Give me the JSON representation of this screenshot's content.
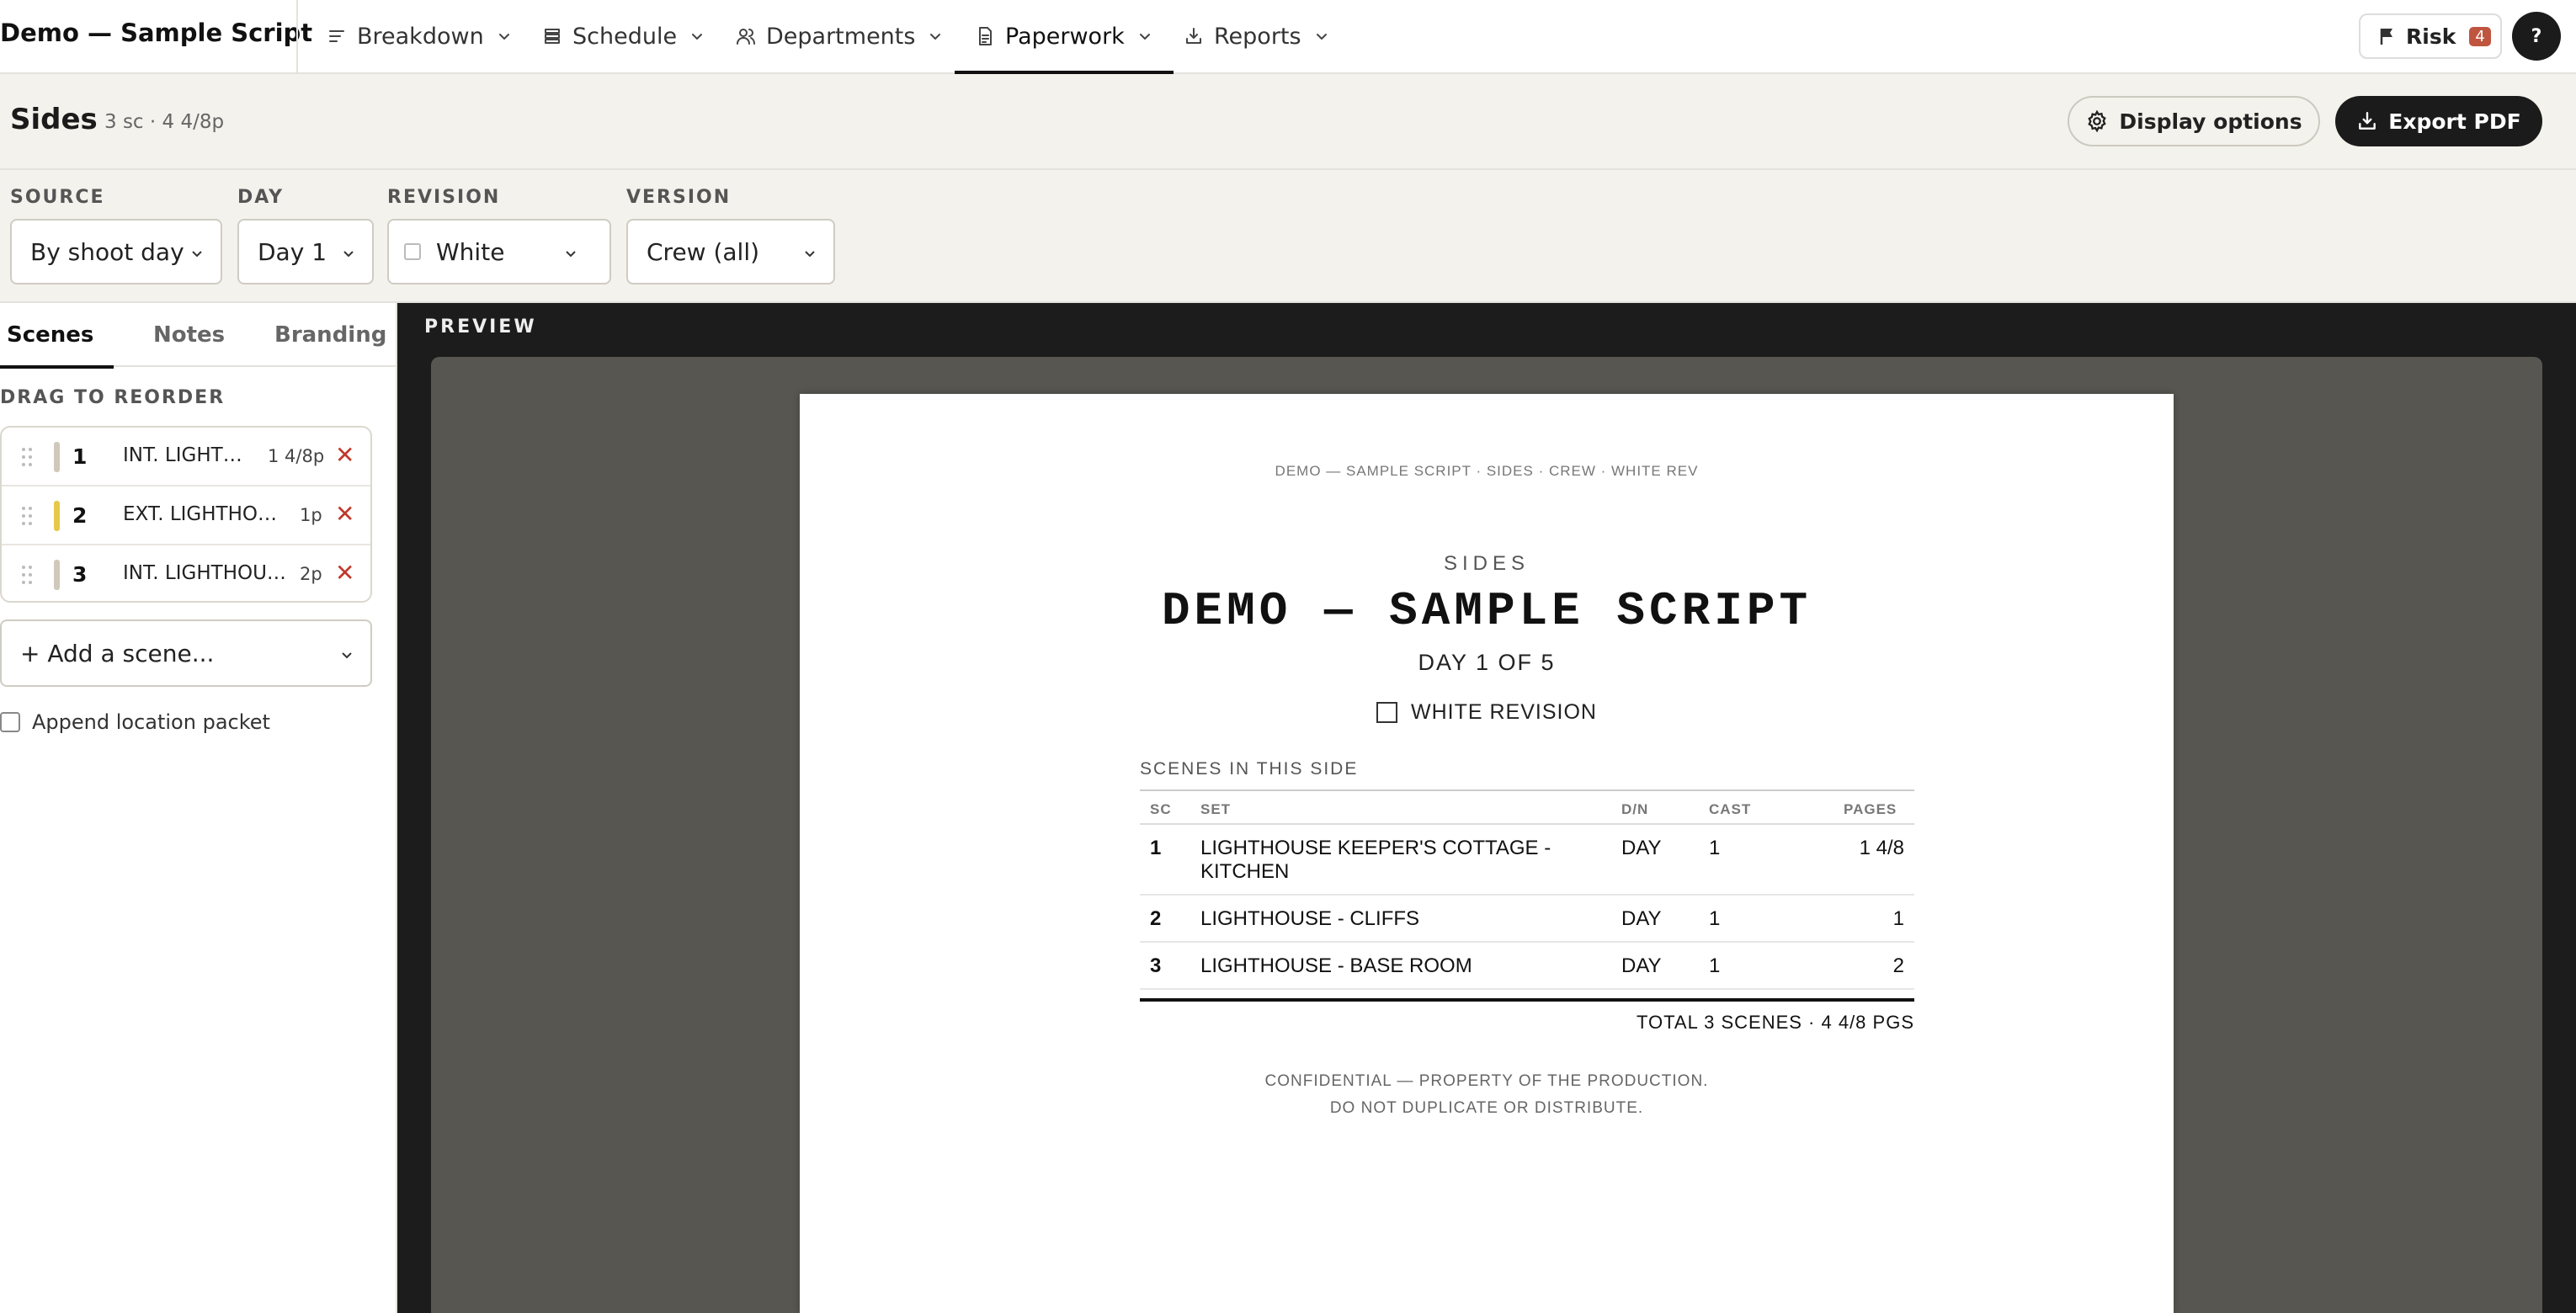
{
  "app": {
    "title": "Demo — Sample Script"
  },
  "nav": {
    "items": [
      {
        "label": "Breakdown",
        "icon": "list-icon"
      },
      {
        "label": "Schedule",
        "icon": "layers-icon"
      },
      {
        "label": "Departments",
        "icon": "users-icon"
      },
      {
        "label": "Paperwork",
        "icon": "document-icon",
        "active": true
      },
      {
        "label": "Reports",
        "icon": "download-icon"
      }
    ],
    "risk": {
      "label": "Risk",
      "count": "4"
    },
    "help": {
      "label": "?"
    }
  },
  "header": {
    "title": "Sides",
    "meta": "3 sc · 4 4/8p",
    "display_options_label": "Display options",
    "export_label": "Export PDF"
  },
  "filters": {
    "source": {
      "label": "SOURCE",
      "value": "By shoot day"
    },
    "day": {
      "label": "DAY",
      "value": "Day 1"
    },
    "revision": {
      "label": "REVISION",
      "value": "White"
    },
    "version": {
      "label": "VERSION",
      "value": "Crew (all)"
    }
  },
  "sidebar": {
    "tabs": [
      "Scenes",
      "Notes",
      "Branding"
    ],
    "active_tab": "Scenes",
    "reorder_label": "DRAG TO REORDER",
    "scenes": [
      {
        "num": "1",
        "title": "INT. LIGHT…",
        "pages": "1 4/8p",
        "color": "#cfc8bb"
      },
      {
        "num": "2",
        "title": "EXT. LIGHTHO…",
        "pages": "1p",
        "color": "#e7c84a"
      },
      {
        "num": "3",
        "title": "INT. LIGHTHOU…",
        "pages": "2p",
        "color": "#cfc8bb"
      }
    ],
    "remove_symbol": "✕",
    "add_scene_placeholder": "+ Add a scene...",
    "append_label": "Append location packet"
  },
  "preview": {
    "label": "PREVIEW",
    "paper": {
      "header": "DEMO — SAMPLE SCRIPT · SIDES · CREW · WHITE REV",
      "kicker": "SIDES",
      "title": "DEMO — SAMPLE SCRIPT",
      "day": "DAY 1 OF 5",
      "revision": "WHITE REVISION",
      "scenes_heading": "SCENES IN THIS SIDE",
      "columns": [
        "SC",
        "SET",
        "D/N",
        "CAST",
        "PAGES"
      ],
      "rows": [
        {
          "sc": "1",
          "set": "LIGHTHOUSE KEEPER'S COTTAGE - KITCHEN",
          "dn": "DAY",
          "cast": "1",
          "pages": "1 4/8"
        },
        {
          "sc": "2",
          "set": "LIGHTHOUSE - CLIFFS",
          "dn": "DAY",
          "cast": "1",
          "pages": "1"
        },
        {
          "sc": "3",
          "set": "LIGHTHOUSE - BASE ROOM",
          "dn": "DAY",
          "cast": "1",
          "pages": "2"
        }
      ],
      "total": "TOTAL 3 SCENES · 4 4/8 PGS",
      "footer_line1": "CONFIDENTIAL — PROPERTY OF THE PRODUCTION.",
      "footer_line2": "DO NOT DUPLICATE OR DISTRIBUTE."
    }
  }
}
